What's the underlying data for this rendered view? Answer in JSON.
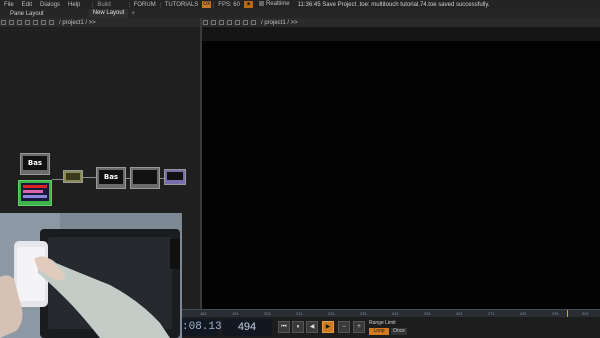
{
  "menu": {
    "items": [
      "File",
      "Edit",
      "Dialogs",
      "Help"
    ],
    "build": "Build",
    "forum": "FORUM",
    "tutorials": "TUTORIALS",
    "chip_tutorials": "OX",
    "fps_label": "FPS: 60",
    "chip_fps": "■",
    "realtime": "Realtime",
    "status": "11:36:45 Save Project .toe: multitouch tutorial.74.toe saved successfully."
  },
  "bar2": {
    "pane_layout": "Pane Layout",
    "new_layout": "New Layout",
    "plus": "+"
  },
  "left_pane": {
    "path": "/ project1 / >>"
  },
  "right_pane": {
    "path": "/ project1 / >>"
  },
  "nodes": {
    "bas1": "Bas",
    "bas2": "Bas"
  },
  "ruler": {
    "ticks": [
      "181",
      "191",
      "201",
      "211",
      "221",
      "231",
      "241",
      "251",
      "261",
      "271",
      "281",
      "291",
      "301"
    ]
  },
  "transport": {
    "timecode": ":08.13",
    "frame": "494",
    "btn_start": "⏮",
    "btn_pause": "⏸",
    "btn_back": "◀",
    "btn_play": "▶",
    "btn_minus": "−",
    "btn_plus": "+",
    "range_limit": "Range Limit",
    "loop": "Loop",
    "once": "Once"
  },
  "colors": {
    "accent": "#d27a1f",
    "node_green": "#3fb34a",
    "viewer_bg": "#030303"
  }
}
